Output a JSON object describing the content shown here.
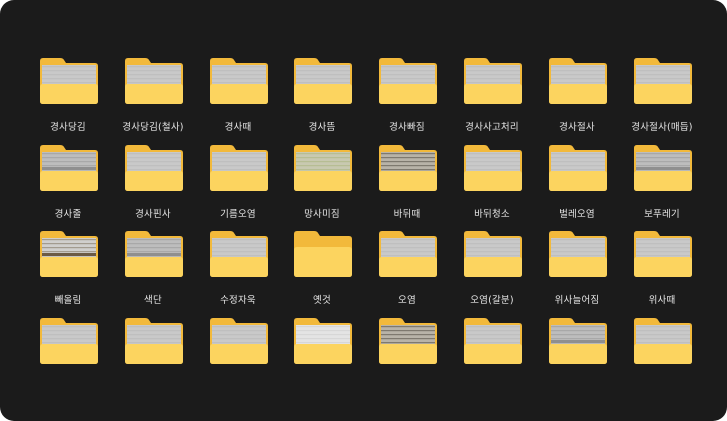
{
  "folders": [
    {
      "label": "경사당김",
      "preview": "plain"
    },
    {
      "label": "경사당김(철사)",
      "preview": "plain"
    },
    {
      "label": "경사때",
      "preview": "plain"
    },
    {
      "label": "경사뜸",
      "preview": "plain"
    },
    {
      "label": "경사빠짐",
      "preview": "plain"
    },
    {
      "label": "경사사고처리",
      "preview": "plain"
    },
    {
      "label": "경사절사",
      "preview": "plain"
    },
    {
      "label": "경사절사(매듭)",
      "preview": "plain"
    },
    {
      "label": "경사줄",
      "preview": "dark"
    },
    {
      "label": "경사핀사",
      "preview": "plain"
    },
    {
      "label": "기름오염",
      "preview": "plain"
    },
    {
      "label": "망사미짐",
      "preview": "green"
    },
    {
      "label": "바뒤때",
      "preview": "striped"
    },
    {
      "label": "바뒤청소",
      "preview": "plain"
    },
    {
      "label": "벌레오염",
      "preview": "plain"
    },
    {
      "label": "보푸레기",
      "preview": "dark"
    },
    {
      "label": "빼올림",
      "preview": "brown"
    },
    {
      "label": "색단",
      "preview": "dark"
    },
    {
      "label": "수정자욱",
      "preview": "plain"
    },
    {
      "label": "옛것",
      "preview": "none"
    },
    {
      "label": "오염",
      "preview": "plain"
    },
    {
      "label": "오염(갈분)",
      "preview": "plain"
    },
    {
      "label": "위사늘어짐",
      "preview": "plain"
    },
    {
      "label": "위사때",
      "preview": "plain"
    },
    {
      "label": "",
      "preview": "plain"
    },
    {
      "label": "",
      "preview": "plain"
    },
    {
      "label": "",
      "preview": "plain"
    },
    {
      "label": "",
      "preview": "white"
    },
    {
      "label": "",
      "preview": "striped"
    },
    {
      "label": "",
      "preview": "plain"
    },
    {
      "label": "",
      "preview": "dark"
    },
    {
      "label": "",
      "preview": "plain"
    }
  ],
  "colors": {
    "background": "#1b1b1b",
    "folder_back": "#f2b93b",
    "folder_front": "#fcd45f",
    "label": "#e6e6e6"
  }
}
